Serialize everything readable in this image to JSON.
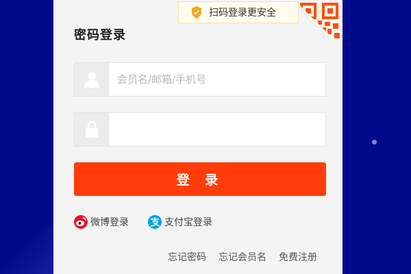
{
  "login": {
    "title": "密码登录",
    "qr_tip": "扫码登录更安全",
    "username": {
      "placeholder": "会员名/邮箱/手机号",
      "value": ""
    },
    "password": {
      "placeholder": "",
      "value": ""
    },
    "submit_label": "登 录",
    "alt_logins": [
      {
        "label": "微博登录",
        "icon": "weibo-icon"
      },
      {
        "label": "支付宝登录",
        "icon": "alipay-icon"
      }
    ],
    "links": [
      "忘记密码",
      "忘记会员名",
      "免费注册"
    ]
  },
  "colors": {
    "background": "#020a8c",
    "panel": "#f4f4f4",
    "primary": "#ff3c0a",
    "tip_bg": "#fefcef",
    "qr": "#ff5000"
  }
}
